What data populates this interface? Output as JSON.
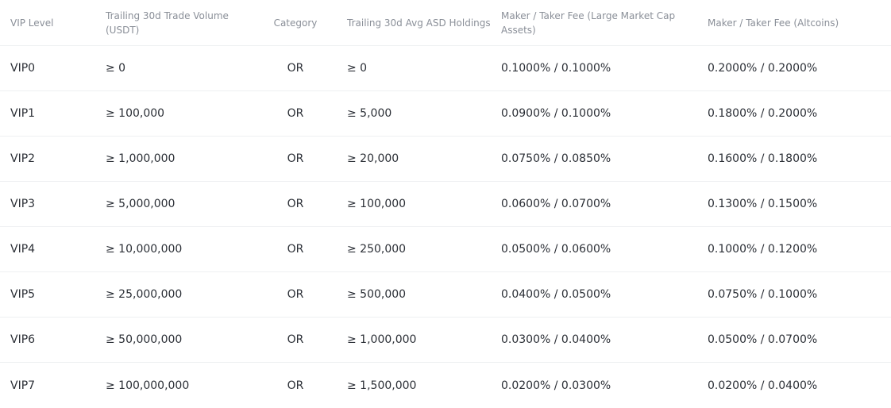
{
  "table": {
    "headers": [
      "VIP Level",
      "Trailing 30d Trade Volume (USDT)",
      "Category",
      "Trailing 30d Avg ASD Holdings",
      "Maker / Taker Fee (Large Market Cap Assets)",
      "Maker / Taker Fee (Altcoins)"
    ],
    "rows": [
      [
        "VIP0",
        "≥ 0",
        "OR",
        "≥ 0",
        "0.1000% / 0.1000%",
        "0.2000% / 0.2000%"
      ],
      [
        "VIP1",
        "≥ 100,000",
        "OR",
        "≥ 5,000",
        "0.0900% / 0.1000%",
        "0.1800% / 0.2000%"
      ],
      [
        "VIP2",
        "≥ 1,000,000",
        "OR",
        "≥ 20,000",
        "0.0750% / 0.0850%",
        "0.1600% / 0.1800%"
      ],
      [
        "VIP3",
        "≥ 5,000,000",
        "OR",
        "≥ 100,000",
        "0.0600% / 0.0700%",
        "0.1300% / 0.1500%"
      ],
      [
        "VIP4",
        "≥ 10,000,000",
        "OR",
        "≥ 250,000",
        "0.0500% / 0.0600%",
        "0.1000% / 0.1200%"
      ],
      [
        "VIP5",
        "≥ 25,000,000",
        "OR",
        "≥ 500,000",
        "0.0400% / 0.0500%",
        "0.0750% / 0.1000%"
      ],
      [
        "VIP6",
        "≥ 50,000,000",
        "OR",
        "≥ 1,000,000",
        "0.0300% / 0.0400%",
        "0.0500% / 0.0700%"
      ],
      [
        "VIP7",
        "≥ 100,000,000",
        "OR",
        "≥ 1,500,000",
        "0.0200% / 0.0300%",
        "0.0200% / 0.0400%"
      ]
    ]
  }
}
